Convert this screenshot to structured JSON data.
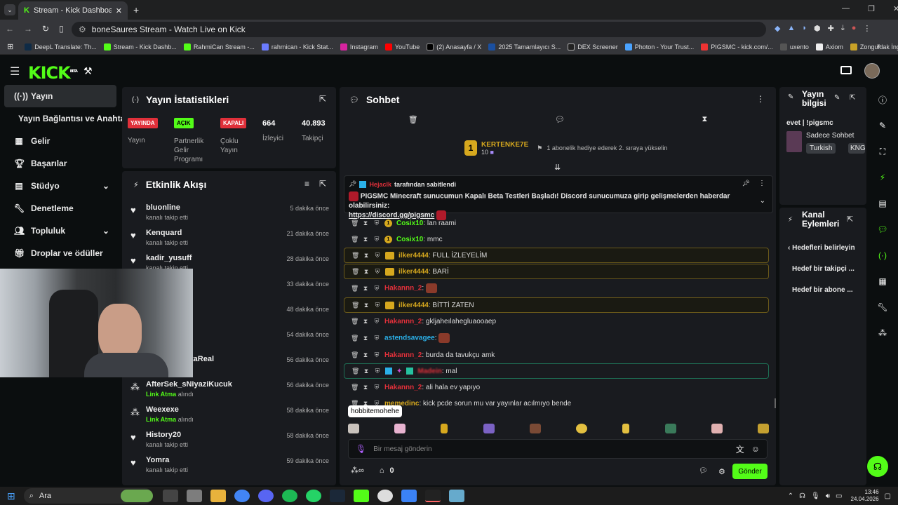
{
  "browser": {
    "tab_title": "Stream - Kick Dashboard",
    "address": "boneSaures Stream - Watch Live on Kick",
    "bookmarks": [
      "DeepL Translate: Th...",
      "Stream - Kick Dashb...",
      "RahmiCan Stream -...",
      "rahmican - Kick Stat...",
      "Instagram",
      "YouTube",
      "(2) Anasayfa / X",
      "2025 Tamamlayıcı S...",
      "DEX Screener",
      "Photon - Your Trust...",
      "PIGSMC - kick.com/...",
      "uxento",
      "Axiom",
      "Zonguldak İngilizce..."
    ]
  },
  "kick": {
    "logo": "KICK",
    "logo_beta": "BETA"
  },
  "sidebar": {
    "items": [
      {
        "label": "Yayın",
        "icon": "broadcast-icon"
      },
      {
        "label": "Yayın Bağlantısı ve Anahtarı",
        "icon": ""
      },
      {
        "label": "Gelir",
        "icon": "money-icon"
      },
      {
        "label": "Başarılar",
        "icon": "trophy-icon"
      },
      {
        "label": "Stüdyo",
        "icon": "studio-icon"
      },
      {
        "label": "Denetleme",
        "icon": "wrench-icon"
      },
      {
        "label": "Topluluk",
        "icon": "community-icon"
      },
      {
        "label": "Droplar ve ödüller",
        "icon": "gift-icon"
      }
    ]
  },
  "stats": {
    "title": "Yayın İstatistikleri",
    "items": [
      {
        "badge": "YAYINDA",
        "label": "Yayın"
      },
      {
        "badge": "AÇIK",
        "label": "Partnerlik Gelir Programı"
      },
      {
        "badge": "KAPALI",
        "label": "Çoklu Yayın"
      },
      {
        "value": "664",
        "label": "İzleyici"
      },
      {
        "value": "40.893",
        "label": "Takipçi"
      }
    ]
  },
  "feed": {
    "title": "Etkinlik Akışı",
    "rows": [
      {
        "name": "bluonline",
        "sub": "kanalı takip etti",
        "time": "5 dakika önce"
      },
      {
        "name": "Kenquard",
        "sub": "kanalı takip etti",
        "time": "21 dakika önce"
      },
      {
        "name": "kadir_yusuff",
        "sub": "kanalı takip etti",
        "time": "28 dakika önce"
      },
      {
        "name": "",
        "sub": "",
        "time": "33 dakika önce"
      },
      {
        "name": "",
        "sub": "",
        "time": "48 dakika önce"
      },
      {
        "name": "",
        "sub": "",
        "time": "54 dakika önce"
      },
      {
        "name": "taReal",
        "sub": "",
        "time": "56 dakika önce"
      },
      {
        "name": "AfterSek_sNiyaziKucuk",
        "sub_bold": "Link Atma",
        "sub": "alındı",
        "time": "56 dakika önce"
      },
      {
        "name": "Weexexe",
        "sub_bold": "Link Atma",
        "sub": "alındı",
        "time": "58 dakika önce"
      },
      {
        "name": "History20",
        "sub": "kanalı takip etti",
        "time": "58 dakika önce"
      },
      {
        "name": "Yomra",
        "sub": "kanalı takip etti",
        "time": "59 dakika önce"
      }
    ]
  },
  "chat": {
    "title": "Sohbet",
    "gift_user": "KERTENKE7E",
    "gift_count": "10",
    "gift_text": "1 abonelik hediye ederek 2. sıraya yükselin",
    "pinned_by": "Hejaclk",
    "pinned_suffix": "tarafından sabitlendi",
    "pinned_text": "PIGSMC Minecraft sunucumun Kapalı Beta Testleri Başladı! Discord sunucumuza girip gelişmelerden haberdar olabilirsiniz:",
    "pinned_link": "https://discord.gg/pigsmc",
    "messages": [
      {
        "user": "Cosix10",
        "text": "lan raami",
        "color": "#53fc18",
        "style": ""
      },
      {
        "user": "Cosix10",
        "text": "mmc",
        "color": "#53fc18",
        "style": ""
      },
      {
        "user": "ilker4444",
        "text": "FULL İZLEYELİM",
        "color": "#d6a81e",
        "style": "hl"
      },
      {
        "user": "ilker4444",
        "text": "BARİ",
        "color": "#d6a81e",
        "style": "hl"
      },
      {
        "user": "Hakannn_2",
        "text": "",
        "color": "#e0303a",
        "style": "emote"
      },
      {
        "user": "ilker4444",
        "text": "BİTTİ ZATEN",
        "color": "#d6a81e",
        "style": "hl"
      },
      {
        "user": "Hakannn_2",
        "text": "gkljaheılahegluaooaep",
        "color": "#e0303a",
        "style": ""
      },
      {
        "user": "astendsavagee",
        "text": "",
        "color": "#2bb0e8",
        "style": "emote"
      },
      {
        "user": "Hakannn_2",
        "text": "burda da tavukçu amk",
        "color": "#e0303a",
        "style": ""
      },
      {
        "user": "Madein",
        "text": "mal",
        "color": "#e0303a",
        "style": "hlg"
      },
      {
        "user": "Hakannn_2",
        "text": "ali hala ev yapıyo",
        "color": "#e0303a",
        "style": ""
      },
      {
        "user": "memedinc",
        "text": "kick pcde sorun mu var yayınlar acılmıyo bende",
        "color": "#d6a81e",
        "style": ""
      }
    ],
    "tooltip": "hobbitemohehe",
    "input_placeholder": "Bir mesaj gönderin",
    "points": "0",
    "send_label": "Gönder"
  },
  "stream_info": {
    "title": "Yayın bilgisi",
    "stream_title": "evet | !pigsmc",
    "category": "Sadece Sohbet",
    "tags": [
      "Turkish",
      "KNG"
    ]
  },
  "channel_actions": {
    "title": "Kanal Eylemleri",
    "back_label": "Hedefleri belirleyin",
    "items": [
      "Hedef bir takipçi ...",
      "Hedef bir abone ..."
    ]
  },
  "taskbar": {
    "search": "Ara",
    "time": "13:46",
    "date": "24.04.2026"
  },
  "colors": {
    "accent": "#53fc18",
    "live_red": "#e0303a"
  }
}
